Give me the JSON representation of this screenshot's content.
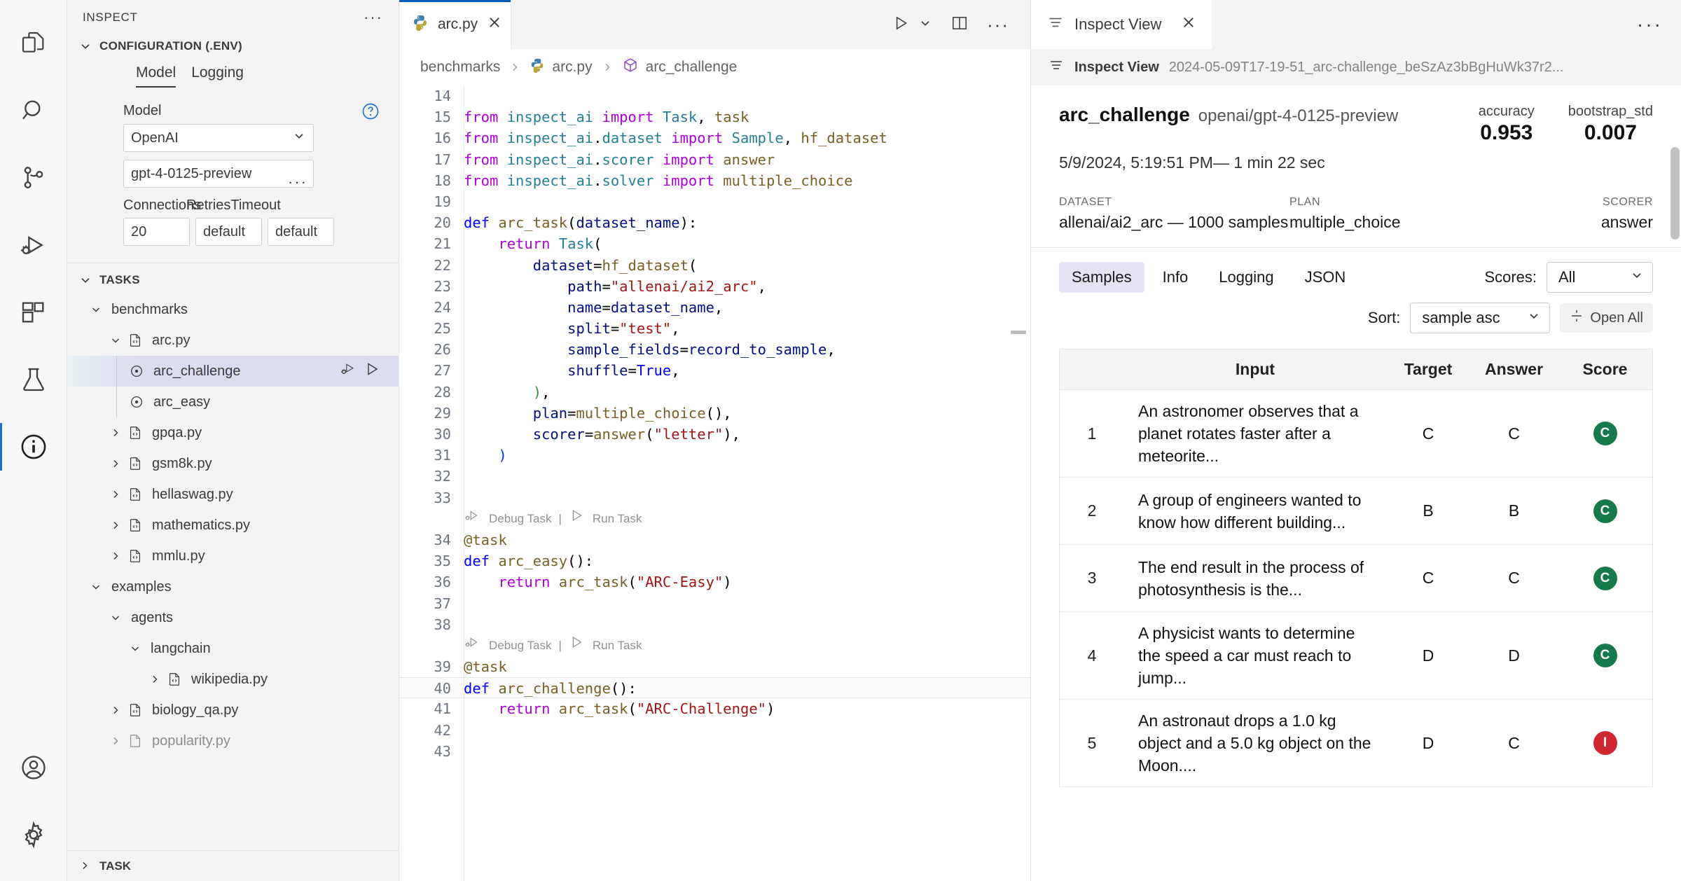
{
  "activity_bar": {
    "items": [
      {
        "name": "explorer",
        "icon": "files-icon"
      },
      {
        "name": "search",
        "icon": "search-icon"
      },
      {
        "name": "source-control",
        "icon": "source-control-icon"
      },
      {
        "name": "run-and-debug",
        "icon": "run-debug-icon"
      },
      {
        "name": "extensions",
        "icon": "extensions-icon"
      },
      {
        "name": "testing",
        "icon": "beaker-icon"
      },
      {
        "name": "inspect",
        "icon": "info-circle-icon"
      },
      {
        "name": "accounts",
        "icon": "account-icon"
      },
      {
        "name": "manage",
        "icon": "gear-icon"
      }
    ]
  },
  "sidebar": {
    "title": "INSPECT",
    "more_actions": "···",
    "configuration": {
      "header": "CONFIGURATION (.ENV)",
      "tabs": [
        {
          "label": "Model",
          "selected": true
        },
        {
          "label": "Logging",
          "selected": false
        }
      ],
      "model_label": "Model",
      "provider_value": "OpenAI",
      "model_value": "gpt-4-0125-preview",
      "help_icon": "question-circle-icon",
      "more_icon": "ellipsis-icon",
      "fields": [
        {
          "label": "Connections",
          "value": "20"
        },
        {
          "label": "Retries",
          "value": "default"
        },
        {
          "label": "Timeout",
          "value": "default"
        }
      ]
    },
    "tasks": {
      "header": "TASKS",
      "tree": [
        {
          "label": "benchmarks",
          "depth": 0,
          "type": "folder",
          "expanded": true
        },
        {
          "label": "arc.py",
          "depth": 1,
          "type": "file",
          "expanded": true
        },
        {
          "label": "arc_challenge",
          "depth": 2,
          "type": "task",
          "selected": true,
          "actions": [
            "debug-task-icon",
            "run-task-icon"
          ]
        },
        {
          "label": "arc_easy",
          "depth": 2,
          "type": "task",
          "selected": false
        },
        {
          "label": "gpqa.py",
          "depth": 1,
          "type": "file",
          "expanded": false
        },
        {
          "label": "gsm8k.py",
          "depth": 1,
          "type": "file",
          "expanded": false
        },
        {
          "label": "hellaswag.py",
          "depth": 1,
          "type": "file",
          "expanded": false
        },
        {
          "label": "mathematics.py",
          "depth": 1,
          "type": "file",
          "expanded": false
        },
        {
          "label": "mmlu.py",
          "depth": 1,
          "type": "file",
          "expanded": false
        },
        {
          "label": "examples",
          "depth": 0,
          "type": "folder",
          "expanded": true
        },
        {
          "label": "agents",
          "depth": 1,
          "type": "folder",
          "expanded": true
        },
        {
          "label": "langchain",
          "depth": 2,
          "type": "folder",
          "expanded": true
        },
        {
          "label": "wikipedia.py",
          "depth": 3,
          "type": "file",
          "expanded": false
        },
        {
          "label": "biology_qa.py",
          "depth": 1,
          "type": "file",
          "expanded": false
        },
        {
          "label": "popularity.py",
          "depth": 1,
          "type": "file",
          "expanded": false
        }
      ]
    },
    "bottom_panel": "TASK"
  },
  "editor": {
    "tab": {
      "label": "arc.py",
      "icon": "python-icon",
      "close_icon": "close-icon"
    },
    "tab_actions": [
      "run-icon",
      "chevron-down-icon",
      "split-editor-icon",
      "ellipsis-icon"
    ],
    "breadcrumb": [
      "benchmarks",
      "arc.py",
      "arc_challenge"
    ],
    "first_line": 14,
    "lines": [
      {
        "n": 14,
        "tokens": []
      },
      {
        "n": 15,
        "tokens": [
          [
            "kw",
            "from "
          ],
          [
            "ident",
            "inspect_ai"
          ],
          [
            "kw",
            " import "
          ],
          [
            "ident",
            "Task"
          ],
          [
            "plain",
            ", "
          ],
          [
            "fn",
            "task"
          ]
        ]
      },
      {
        "n": 16,
        "tokens": [
          [
            "kw",
            "from "
          ],
          [
            "ident",
            "inspect_ai"
          ],
          [
            "plain",
            "."
          ],
          [
            "ident",
            "dataset"
          ],
          [
            "kw",
            " import "
          ],
          [
            "ident",
            "Sample"
          ],
          [
            "plain",
            ", "
          ],
          [
            "fn",
            "hf_dataset"
          ]
        ]
      },
      {
        "n": 17,
        "tokens": [
          [
            "kw",
            "from "
          ],
          [
            "ident",
            "inspect_ai"
          ],
          [
            "plain",
            "."
          ],
          [
            "ident",
            "scorer"
          ],
          [
            "kw",
            " import "
          ],
          [
            "fn",
            "answer"
          ]
        ]
      },
      {
        "n": 18,
        "tokens": [
          [
            "kw",
            "from "
          ],
          [
            "ident",
            "inspect_ai"
          ],
          [
            "plain",
            "."
          ],
          [
            "ident",
            "solver"
          ],
          [
            "kw",
            " import "
          ],
          [
            "fn",
            "multiple_choice"
          ]
        ]
      },
      {
        "n": 19,
        "tokens": []
      },
      {
        "n": 20,
        "tokens": [
          [
            "kw2",
            "def "
          ],
          [
            "fn",
            "arc_task"
          ],
          [
            "plain",
            "("
          ],
          [
            "var",
            "dataset_name"
          ],
          [
            "plain",
            "):"
          ]
        ]
      },
      {
        "n": 21,
        "tokens": [
          [
            "plain",
            "    "
          ],
          [
            "kw",
            "return "
          ],
          [
            "ident",
            "Task"
          ],
          [
            "plain",
            "("
          ]
        ]
      },
      {
        "n": 22,
        "tokens": [
          [
            "plain",
            "        "
          ],
          [
            "var",
            "dataset"
          ],
          [
            "plain",
            "="
          ],
          [
            "fn",
            "hf_dataset"
          ],
          [
            "plain",
            "("
          ]
        ]
      },
      {
        "n": 23,
        "tokens": [
          [
            "plain",
            "            "
          ],
          [
            "var",
            "path"
          ],
          [
            "plain",
            "="
          ],
          [
            "str",
            "\"allenai/ai2_arc\""
          ],
          [
            "plain",
            ","
          ]
        ]
      },
      {
        "n": 24,
        "tokens": [
          [
            "plain",
            "            "
          ],
          [
            "var",
            "name"
          ],
          [
            "plain",
            "="
          ],
          [
            "var",
            "dataset_name"
          ],
          [
            "plain",
            ","
          ]
        ]
      },
      {
        "n": 25,
        "tokens": [
          [
            "plain",
            "            "
          ],
          [
            "var",
            "split"
          ],
          [
            "plain",
            "="
          ],
          [
            "str",
            "\"test\""
          ],
          [
            "plain",
            ","
          ]
        ]
      },
      {
        "n": 26,
        "tokens": [
          [
            "plain",
            "            "
          ],
          [
            "var",
            "sample_fields"
          ],
          [
            "plain",
            "="
          ],
          [
            "var",
            "record_to_sample"
          ],
          [
            "plain",
            ","
          ]
        ]
      },
      {
        "n": 27,
        "tokens": [
          [
            "plain",
            "            "
          ],
          [
            "var",
            "shuffle"
          ],
          [
            "plain",
            "="
          ],
          [
            "kw2",
            "True"
          ],
          [
            "plain",
            ","
          ]
        ]
      },
      {
        "n": 28,
        "tokens": [
          [
            "plain",
            "        "
          ],
          [
            "paren-g",
            ")"
          ],
          [
            "plain",
            ","
          ]
        ]
      },
      {
        "n": 29,
        "tokens": [
          [
            "plain",
            "        "
          ],
          [
            "var",
            "plan"
          ],
          [
            "plain",
            "="
          ],
          [
            "fn",
            "multiple_choice"
          ],
          [
            "plain",
            "(),"
          ]
        ]
      },
      {
        "n": 30,
        "tokens": [
          [
            "plain",
            "        "
          ],
          [
            "var",
            "scorer"
          ],
          [
            "plain",
            "="
          ],
          [
            "fn",
            "answer"
          ],
          [
            "plain",
            "("
          ],
          [
            "str",
            "\"letter\""
          ],
          [
            "plain",
            "),"
          ]
        ]
      },
      {
        "n": 31,
        "tokens": [
          [
            "plain",
            "    "
          ],
          [
            "paren-y",
            ")"
          ]
        ]
      },
      {
        "n": 32,
        "tokens": []
      },
      {
        "n": 33,
        "tokens": []
      },
      {
        "codelens": true,
        "debug": "Debug Task",
        "run": "Run Task"
      },
      {
        "n": 34,
        "tokens": [
          [
            "deco",
            "@task"
          ]
        ]
      },
      {
        "n": 35,
        "tokens": [
          [
            "kw2",
            "def "
          ],
          [
            "fn",
            "arc_easy"
          ],
          [
            "plain",
            "():"
          ]
        ]
      },
      {
        "n": 36,
        "tokens": [
          [
            "plain",
            "    "
          ],
          [
            "kw",
            "return "
          ],
          [
            "fn",
            "arc_task"
          ],
          [
            "plain",
            "("
          ],
          [
            "str",
            "\"ARC-Easy\""
          ],
          [
            "plain",
            ")"
          ]
        ]
      },
      {
        "n": 37,
        "tokens": []
      },
      {
        "n": 38,
        "tokens": []
      },
      {
        "codelens": true,
        "debug": "Debug Task",
        "run": "Run Task"
      },
      {
        "n": 39,
        "tokens": [
          [
            "deco",
            "@task"
          ]
        ]
      },
      {
        "n": 40,
        "tokens": [
          [
            "kw2",
            "def "
          ],
          [
            "fn",
            "arc_challenge"
          ],
          [
            "plain",
            "():"
          ]
        ],
        "current": true
      },
      {
        "n": 41,
        "tokens": [
          [
            "plain",
            "    "
          ],
          [
            "kw",
            "return "
          ],
          [
            "fn",
            "arc_task"
          ],
          [
            "plain",
            "("
          ],
          [
            "str",
            "\"ARC-Challenge\""
          ],
          [
            "plain",
            ")"
          ]
        ]
      },
      {
        "n": 42,
        "tokens": []
      },
      {
        "n": 43,
        "tokens": []
      }
    ]
  },
  "inspect_view": {
    "tab_label": "Inspect View",
    "tab_icon": "list-icon",
    "close_icon": "close-icon",
    "tab_more_icon": "ellipsis-icon",
    "breadcrumb_title": "Inspect View",
    "breadcrumb_file": "2024-05-09T17-19-51_arc-challenge_beSzAz3bBgHuWk37r2...",
    "task_name": "arc_challenge",
    "model": "openai/gpt-4-0125-preview",
    "datetime": "5/9/2024, 5:19:51 PM— 1 min 22 sec",
    "metrics": [
      {
        "label": "accuracy",
        "value": "0.953"
      },
      {
        "label": "bootstrap_std",
        "value": "0.007"
      }
    ],
    "meta": [
      {
        "label": "DATASET",
        "value": "allenai/ai2_arc — 1000 samples"
      },
      {
        "label": "PLAN",
        "value": "multiple_choice"
      },
      {
        "label": "SCORER",
        "value": "answer"
      }
    ],
    "nav_tabs": [
      {
        "label": "Samples",
        "selected": true
      },
      {
        "label": "Info",
        "selected": false
      },
      {
        "label": "Logging",
        "selected": false
      },
      {
        "label": "JSON",
        "selected": false
      }
    ],
    "scores_label": "Scores:",
    "scores_value": "All",
    "sort_label": "Sort:",
    "sort_value": "sample asc",
    "open_all_label": "Open All",
    "open_all_icon": "expand-icon",
    "table": {
      "headers": [
        "",
        "Input",
        "Target",
        "Answer",
        "Score"
      ],
      "rows": [
        {
          "id": "1",
          "input": "An astronomer observes that a planet rotates faster after a meteorite...",
          "target": "C",
          "answer": "C",
          "score": "C",
          "correct": true
        },
        {
          "id": "2",
          "input": "A group of engineers wanted to know how different building...",
          "target": "B",
          "answer": "B",
          "score": "C",
          "correct": true
        },
        {
          "id": "3",
          "input": "The end result in the process of photosynthesis is the...",
          "target": "C",
          "answer": "C",
          "score": "C",
          "correct": true
        },
        {
          "id": "4",
          "input": "A physicist wants to determine the speed a car must reach to jump...",
          "target": "D",
          "answer": "D",
          "score": "C",
          "correct": true
        },
        {
          "id": "5",
          "input": "An astronaut drops a 1.0 kg object and a 5.0 kg object on the Moon....",
          "target": "D",
          "answer": "C",
          "score": "I",
          "correct": false
        }
      ]
    }
  },
  "colors": {
    "accent": "#005fb8",
    "correct": "#16794c",
    "incorrect": "#d0262f",
    "selection": "#dcdcf0"
  }
}
